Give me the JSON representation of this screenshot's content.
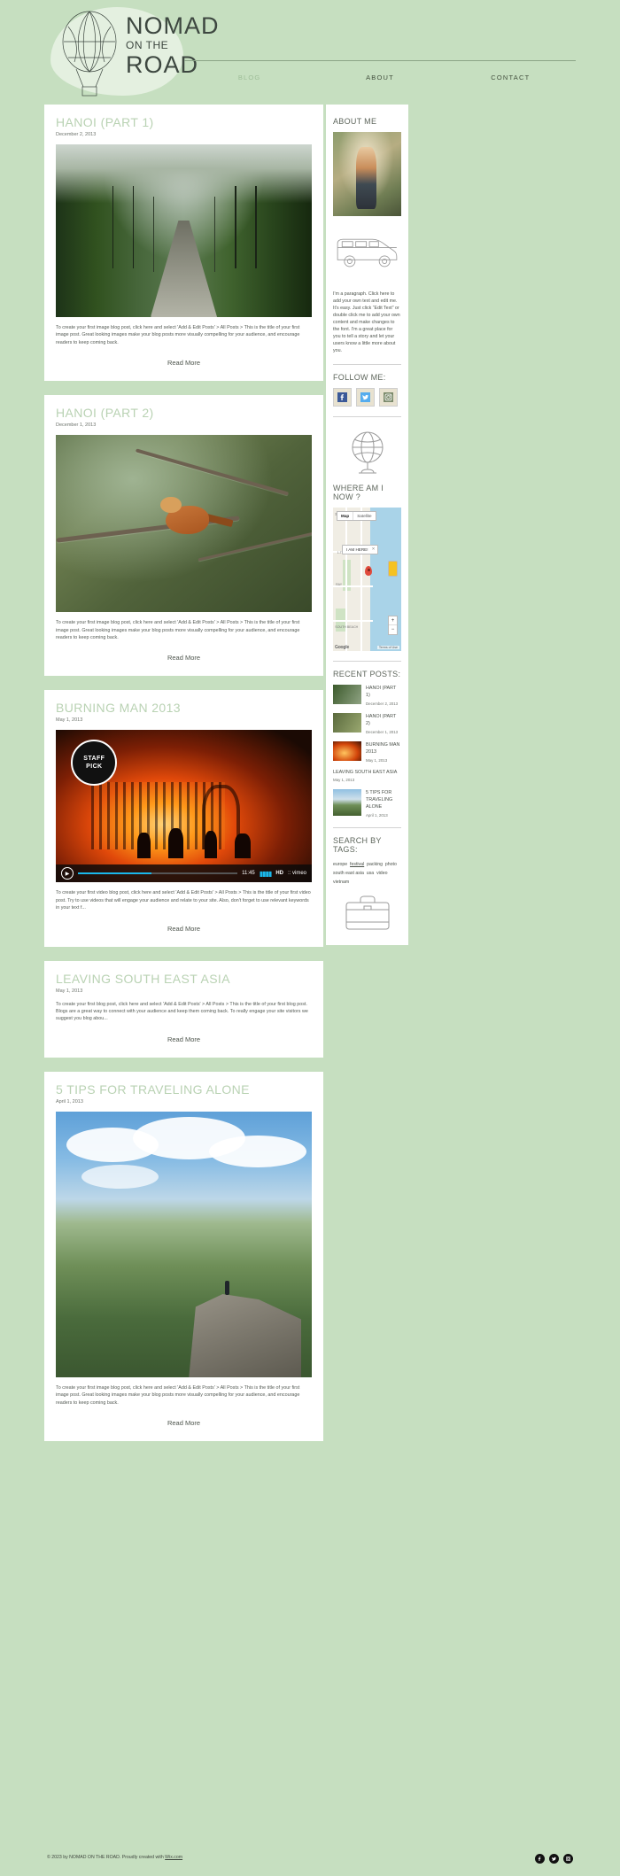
{
  "site": {
    "logo_line1": "NOMAD",
    "logo_line2": "ON THE",
    "logo_line3": "ROAD",
    "logo_icon": "hot-air-balloon-icon"
  },
  "nav": {
    "items": [
      {
        "label": "BLOG",
        "active": true
      },
      {
        "label": "ABOUT",
        "active": false
      },
      {
        "label": "CONTACT",
        "active": false
      }
    ]
  },
  "posts": [
    {
      "title": "HANOI (PART 1)",
      "date": "December 2, 2013",
      "body": "To create your first image blog post, click here and select 'Add & Edit Posts' > All Posts > This is the title of your first image post. Great looking images make your blog posts more visually compelling for your audience, and encourage readers to keep coming back.",
      "read_more": "Read More",
      "media": "jungle-suspension-bridge-photo"
    },
    {
      "title": "HANOI (PART 2)",
      "date": "December 1, 2013",
      "body": "To create your first image blog post, click here and select 'Add & Edit Posts' > All Posts > This is the title of your first image post. Great looking images make your blog posts more visually compelling for your audience, and encourage readers to keep coming back.",
      "read_more": "Read More",
      "media": "bird-on-branch-photo"
    },
    {
      "title": "BURNING MAN 2013",
      "date": "May 1, 2013",
      "body": "To create your first video blog post, click here and select 'Add & Edit Posts' > All Posts > This is the title of your first video post. Try to use videos that will engage your audience and relate to your site. Also, don't forget to use relevant keywords in your text f...",
      "read_more": "Read More",
      "media": "burning-man-video"
    },
    {
      "title": "LEAVING SOUTH EAST ASIA",
      "date": "May 1, 2013",
      "body": "To create your first blog post, click here and select 'Add & Edit Posts' > All Posts > This is the title of your first blog post. Blogs are a great way to connect with your audience and keep them coming back. To really engage your site visitors we suggest you blog abou...",
      "read_more": "Read More",
      "media": "none"
    },
    {
      "title": "5 TIPS FOR TRAVELING ALONE",
      "date": "April 1, 2013",
      "body": "To create your first image blog post, click here and select 'Add & Edit Posts' > All Posts > This is the title of your first image post. Great looking images make your blog posts more visually compelling for your audience, and encourage readers to keep coming back.",
      "read_more": "Read More",
      "media": "cliff-traveler-photo"
    }
  ],
  "video": {
    "staff_pick_line1": "STAFF",
    "staff_pick_line2": "PICK",
    "time": "11:45",
    "hd_label": "HD",
    "brand": ":: vimeo"
  },
  "sidebar": {
    "about": {
      "heading": "ABOUT ME",
      "photo": "hiker-portrait-photo",
      "illustration": "camper-van-icon",
      "text": "I'm a paragraph. Click here to add your own text and edit me. It's easy. Just click “Edit Text” or double click me to add your own content and make changes to the font. I'm a great place for you to tell a story and let your users know a little more about you."
    },
    "follow": {
      "heading": "FOLLOW ME:",
      "icons": [
        "facebook-icon",
        "twitter-icon",
        "instagram-icon"
      ],
      "illustration": "globe-icon"
    },
    "where": {
      "heading": "WHERE AM I NOW ?",
      "map_button": "Map",
      "satellite_button": "Satellite",
      "marker_label": "I AM HERE!",
      "marker_close": "✕",
      "neighborhood": "SOUTH BEACH",
      "street1": "1-T Park",
      "street2": "RAY",
      "street3": "SOUTH BEACH",
      "street4": "HARBOR",
      "zoom_in": "+",
      "zoom_out": "−",
      "attribution": "Google",
      "terms": "Terms of Use"
    },
    "recent": {
      "heading": "RECENT POSTS:",
      "items": [
        {
          "title": "HANOI (PART 1)",
          "date": "December 2, 2013",
          "has_thumb": true
        },
        {
          "title": "HANOI (PART 2)",
          "date": "December 1, 2013",
          "has_thumb": true
        },
        {
          "title": "BURNING MAN 2013",
          "date": "May 1, 2013",
          "has_thumb": true
        },
        {
          "title": "LEAVING SOUTH EAST ASIA",
          "date": "May 1, 2013",
          "has_thumb": false
        },
        {
          "title": "5 TIPS FOR TRAVELING ALONE",
          "date": "April 1, 2013",
          "has_thumb": true
        }
      ]
    },
    "tags": {
      "heading": "SEARCH BY TAGS:",
      "items": [
        {
          "label": "europe",
          "underline": false
        },
        {
          "label": "festival",
          "underline": true
        },
        {
          "label": "packing",
          "underline": false
        },
        {
          "label": "photo",
          "underline": false
        },
        {
          "label": "south east asia",
          "underline": false
        },
        {
          "label": "usa",
          "underline": false
        },
        {
          "label": "video",
          "underline": false
        },
        {
          "label": "vietnam",
          "underline": false
        }
      ],
      "illustration": "suitcase-icon"
    }
  },
  "footer": {
    "copyright": "© 2023 by NOMAD ON THE ROAD. Proudly created with ",
    "link": "Wix.com",
    "icons": [
      "facebook-icon",
      "twitter-icon",
      "instagram-icon"
    ]
  },
  "colors": {
    "page_bg": "#c6dfc0",
    "card_bg": "#ffffff",
    "title": "#b9d2b3",
    "text": "#4f554e"
  }
}
